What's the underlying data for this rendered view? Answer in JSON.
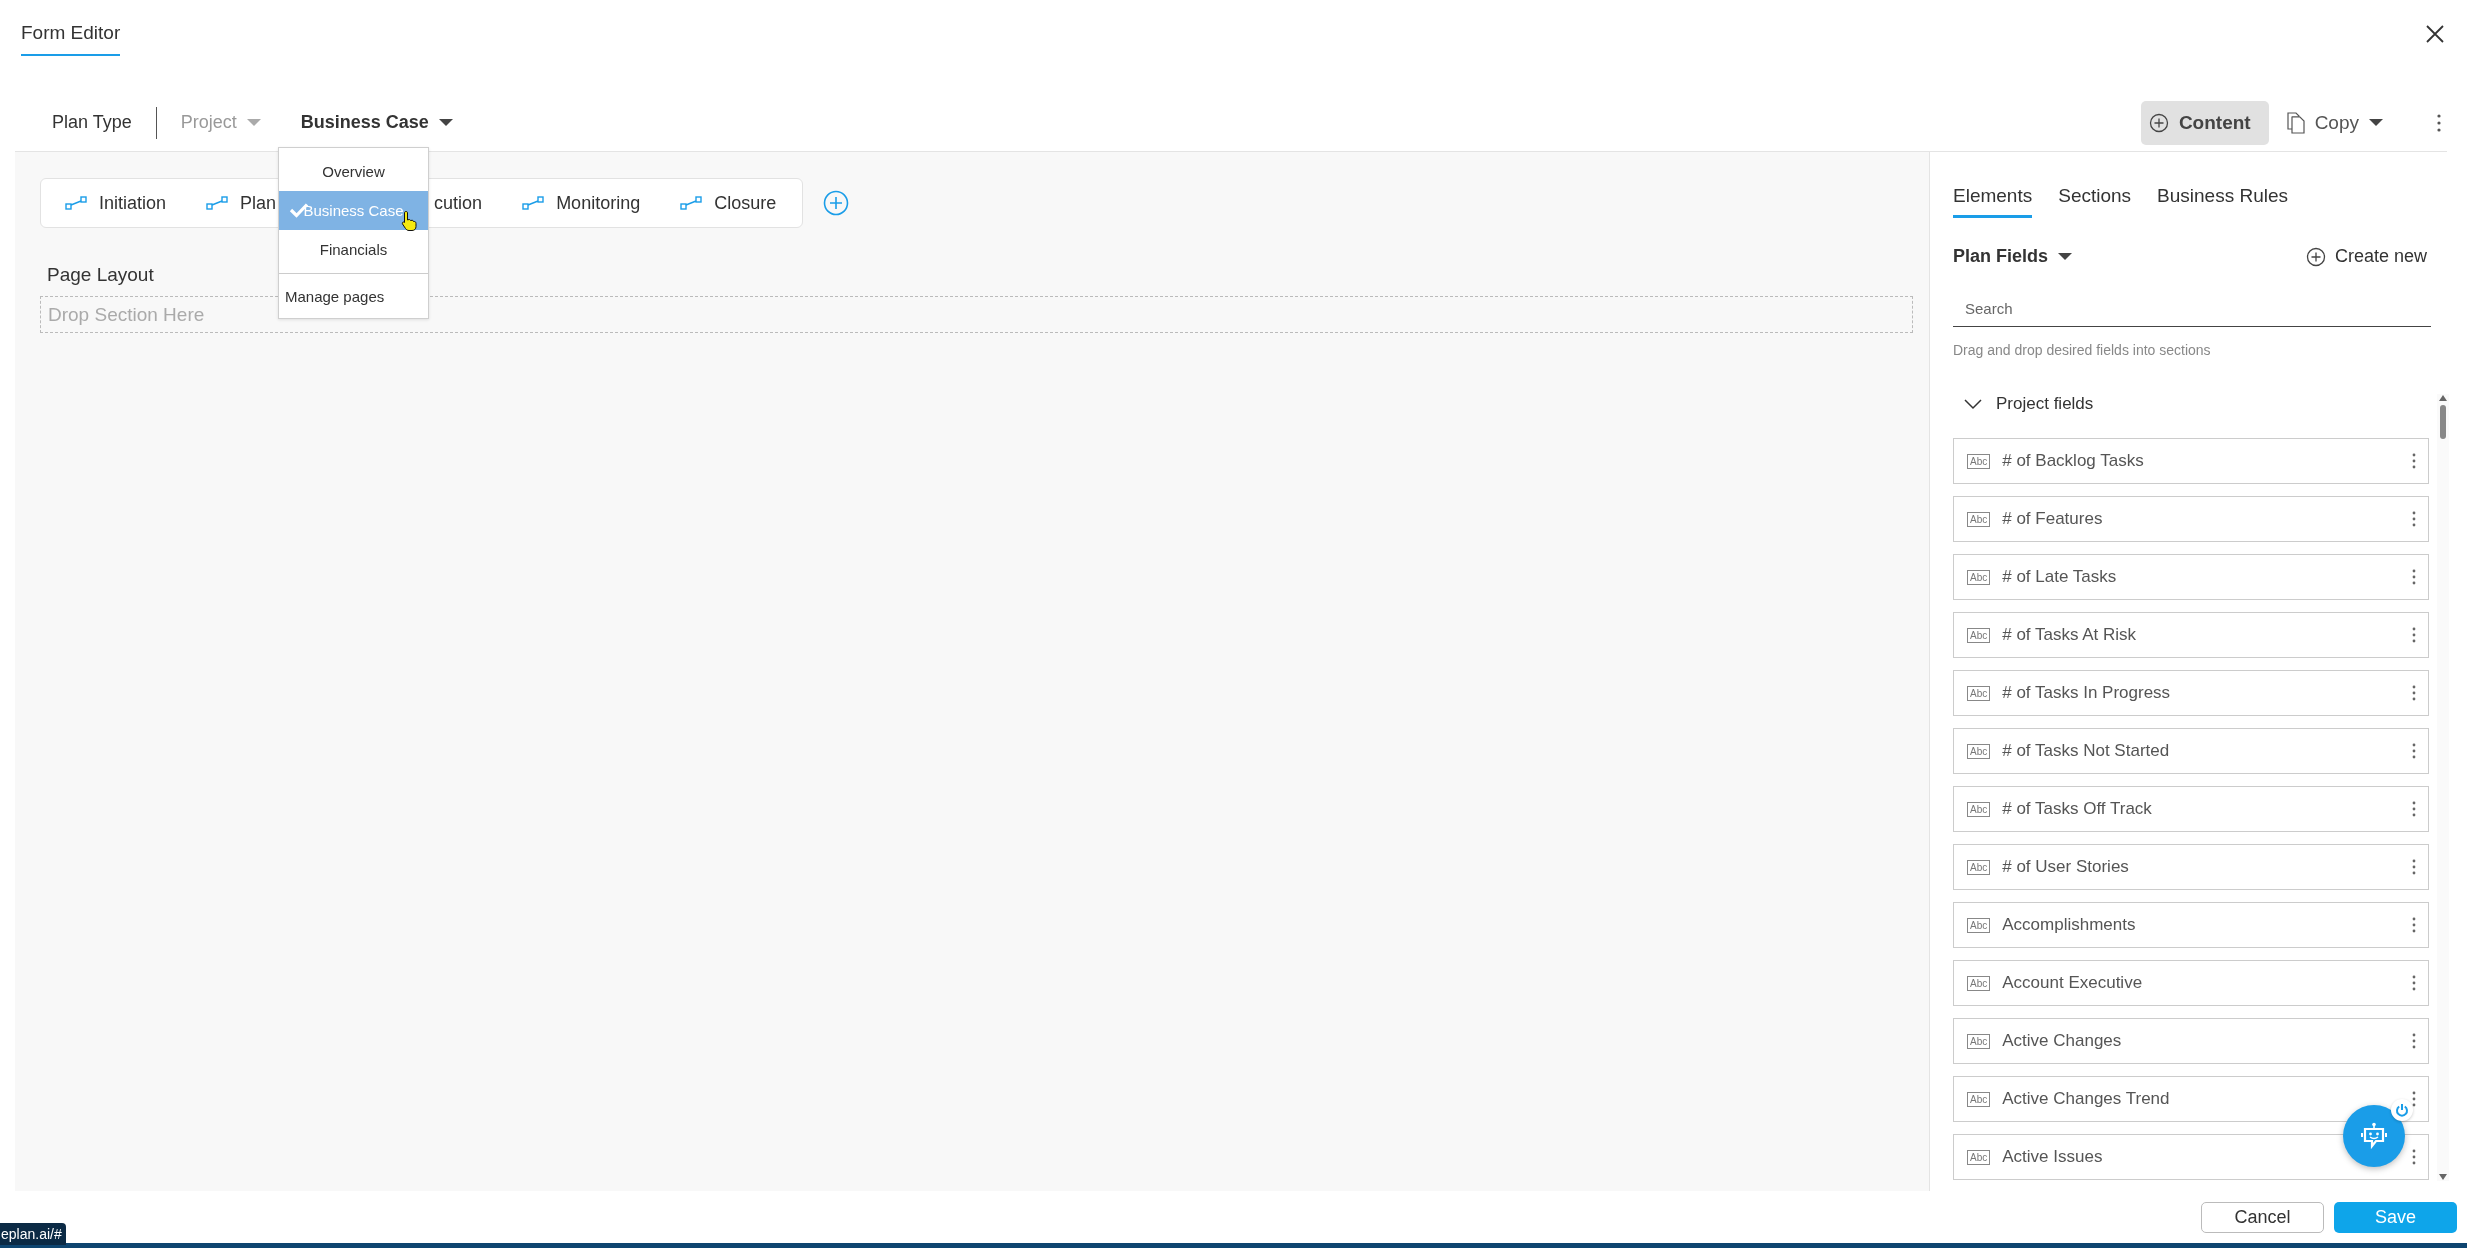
{
  "window": {
    "title": "Form Editor"
  },
  "toolbar": {
    "plan_type_label": "Plan Type",
    "plan_type": {
      "label": "Project",
      "disabled": true
    },
    "page": {
      "label": "Business Case"
    },
    "content_button": "Content",
    "copy_button": "Copy"
  },
  "page_menu": {
    "items": [
      {
        "label": "Overview",
        "selected": false
      },
      {
        "label": "Business Case",
        "selected": true
      },
      {
        "label": "Financials",
        "selected": false
      }
    ],
    "manage": "Manage pages"
  },
  "stages": [
    {
      "label": "Initiation",
      "kind": "stage"
    },
    {
      "label": "Plan",
      "kind": "stage"
    },
    {
      "label": "cution",
      "kind": "covered"
    },
    {
      "label": "Monitoring",
      "kind": "stage"
    },
    {
      "label": "Closure",
      "kind": "stage"
    }
  ],
  "page_layout": {
    "title": "Page Layout",
    "drop_zone": "Drop Section Here"
  },
  "panel": {
    "tabs": [
      {
        "label": "Elements",
        "selected": true
      },
      {
        "label": "Sections",
        "selected": false
      },
      {
        "label": "Business Rules",
        "selected": false
      }
    ],
    "source": "Plan Fields",
    "create_new": "Create new",
    "search": {
      "placeholder": "Search"
    },
    "hint": "Drag and drop desired fields into sections",
    "group": {
      "title": "Project fields",
      "expanded": true,
      "fields": [
        {
          "name": "# of Backlog Tasks",
          "badge": "Abc"
        },
        {
          "name": "# of Features",
          "badge": "Abc"
        },
        {
          "name": "# of Late Tasks",
          "badge": "Abc"
        },
        {
          "name": "# of Tasks At Risk",
          "badge": "Abc"
        },
        {
          "name": "# of Tasks In Progress",
          "badge": "Abc"
        },
        {
          "name": "# of Tasks Not Started",
          "badge": "Abc"
        },
        {
          "name": "# of Tasks Off Track",
          "badge": "Abc"
        },
        {
          "name": "# of User Stories",
          "badge": "Abc"
        },
        {
          "name": "Accomplishments",
          "badge": "Abc"
        },
        {
          "name": "Account Executive",
          "badge": "Abc"
        },
        {
          "name": "Active Changes",
          "badge": "Abc"
        },
        {
          "name": "Active Changes Trend",
          "badge": "Abc"
        },
        {
          "name": "Active Issues",
          "badge": "Abc"
        }
      ]
    }
  },
  "footer": {
    "cancel": "Cancel",
    "save": "Save"
  },
  "status_url": "eplan.ai/#"
}
